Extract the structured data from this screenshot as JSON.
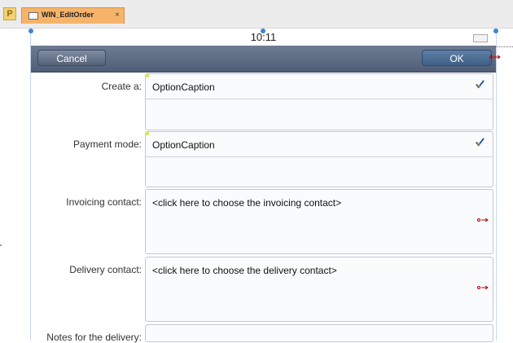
{
  "tab": {
    "title": "WIN_EditOrder",
    "close_symbol": "×",
    "logo_text": "P"
  },
  "status": {
    "time": "10:11"
  },
  "nav": {
    "cancel": "Cancel",
    "ok": "OK"
  },
  "form": {
    "create_label": "Create a:",
    "create_value": "OptionCaption",
    "payment_label": "Payment mode:",
    "payment_value": "OptionCaption",
    "invoicing_label": "Invoicing contact:",
    "invoicing_placeholder": "<click here to choose the invoicing contact>",
    "delivery_label": "Delivery contact:",
    "delivery_placeholder": "<click here to choose the delivery contact>",
    "notes_label": "Notes for the delivery:"
  },
  "colors": {
    "accent": "#3d86d5",
    "tab": "#f6b46b",
    "nav_start": "#6f7d93",
    "nav_end": "#4f5d76"
  },
  "icons": {
    "check": "check-icon",
    "arrow": "arrow-icon"
  }
}
